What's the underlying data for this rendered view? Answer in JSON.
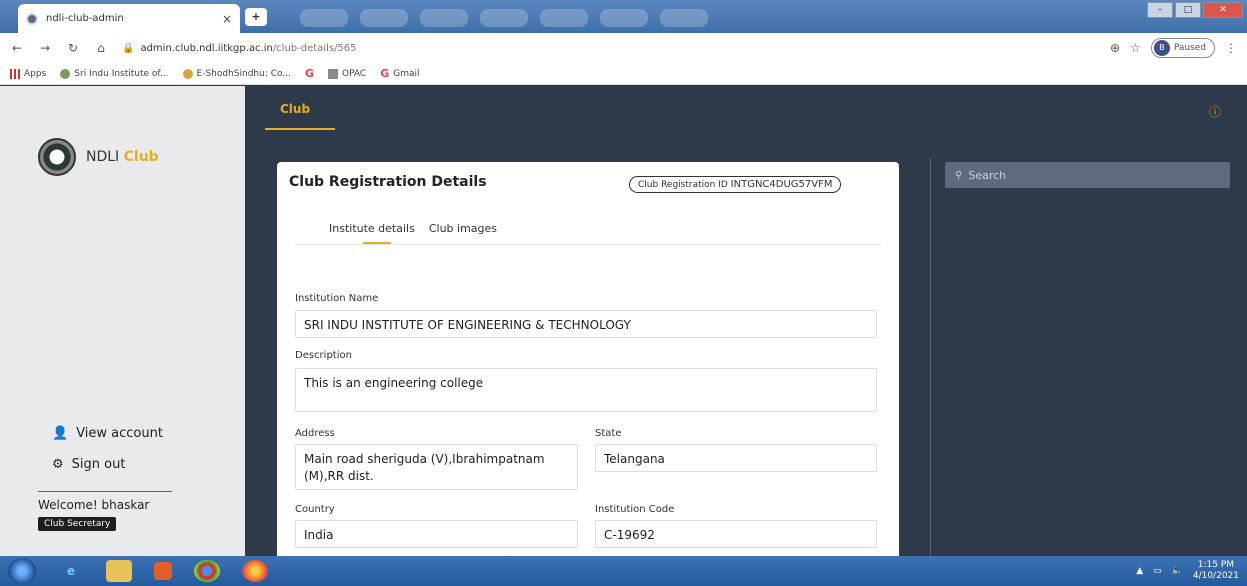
{
  "browser": {
    "tab_title": "ndli-club-admin",
    "tab_close": "×",
    "new_tab": "+",
    "url_host": "admin.club.ndl.iitkgp.ac.in",
    "url_path": "/club-details/565",
    "profile_initial": "B",
    "profile_status": "Paused",
    "bookmarks": [
      "Apps",
      "Sri Indu Institute of...",
      "E-ShodhSindhu: Co...",
      "OPAC",
      "Gmail"
    ]
  },
  "app": {
    "logo_main": "NDLI",
    "logo_accent": "Club",
    "breadcrumb": "Club"
  },
  "sidebar": {
    "view_account": "View account",
    "sign_out": "Sign out",
    "welcome": "Welcome! bhaskar",
    "role": "Club Secretary"
  },
  "card": {
    "title": "Club Registration Details",
    "reg_id_label": "Club Registration ID",
    "reg_id_value": "INTGNC4DUG57VFM",
    "tabs": [
      "Institute details",
      "Club images"
    ]
  },
  "form": {
    "institution_name_label": "Institution Name",
    "institution_name": "SRI INDU INSTITUTE OF ENGINEERING & TECHNOLOGY",
    "description_label": "Description",
    "description": "This is an engineering college",
    "address_label": "Address",
    "address": "Main road sheriguda (V),Ibrahimpatnam (M),RR dist.",
    "state_label": "State",
    "state": "Telangana",
    "country_label": "Country",
    "country": "India",
    "institution_code_label": "Institution Code",
    "institution_code": "C-19692"
  },
  "search": {
    "placeholder": "Search"
  },
  "taskbar": {
    "time": "1:15 PM",
    "date": "4/10/2021"
  },
  "colors": {
    "accent": "#e2b020",
    "dark": "#2e3a49",
    "sidebar": "#e9eaec"
  }
}
